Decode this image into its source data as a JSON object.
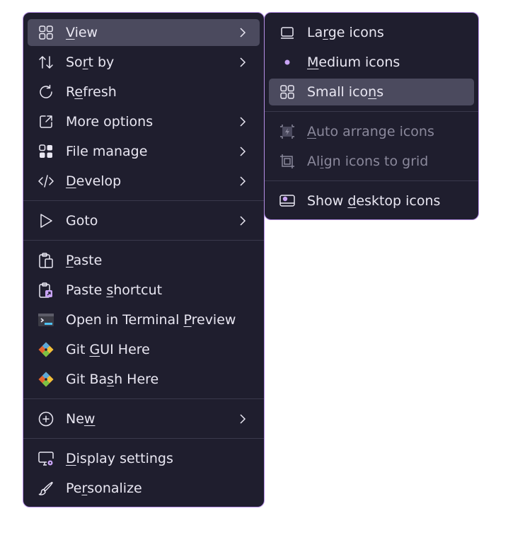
{
  "main_menu": {
    "items": [
      {
        "id": "view",
        "pre": "",
        "ul": "V",
        "post": "iew",
        "icon": "grid-icon",
        "submenu": true,
        "highlighted": true
      },
      {
        "id": "sort-by",
        "pre": "So",
        "ul": "r",
        "post": "t by",
        "icon": "sort-icon",
        "submenu": true
      },
      {
        "id": "refresh",
        "pre": "R",
        "ul": "e",
        "post": "fresh",
        "icon": "refresh-icon",
        "submenu": false
      },
      {
        "id": "more-options",
        "pre": "More options",
        "ul": "",
        "post": "",
        "icon": "external-link-icon",
        "submenu": true
      },
      {
        "id": "file-manage",
        "pre": "File manage",
        "ul": "",
        "post": "",
        "icon": "apps-icon",
        "submenu": true
      },
      {
        "id": "develop",
        "pre": "",
        "ul": "D",
        "post": "evelop",
        "icon": "code-icon",
        "submenu": true
      },
      {
        "id": "goto",
        "pre": "Goto",
        "ul": "",
        "post": "",
        "icon": "cursor-icon",
        "submenu": true
      },
      {
        "id": "paste",
        "pre": "",
        "ul": "P",
        "post": "aste",
        "icon": "paste-icon",
        "submenu": false
      },
      {
        "id": "paste-shortcut",
        "pre": "Paste ",
        "ul": "s",
        "post": "hortcut",
        "icon": "paste-shortcut-icon",
        "submenu": false
      },
      {
        "id": "open-terminal",
        "pre": "Open in Terminal ",
        "ul": "P",
        "post": "review",
        "icon": "terminal-icon",
        "submenu": false
      },
      {
        "id": "git-gui",
        "pre": "Git ",
        "ul": "G",
        "post": "UI Here",
        "icon": "git-icon",
        "submenu": false
      },
      {
        "id": "git-bash",
        "pre": "Git Ba",
        "ul": "s",
        "post": "h Here",
        "icon": "git-icon",
        "submenu": false
      },
      {
        "id": "new",
        "pre": "Ne",
        "ul": "w",
        "post": "",
        "icon": "plus-circle-icon",
        "submenu": true
      },
      {
        "id": "display-settings",
        "pre": "",
        "ul": "D",
        "post": "isplay settings",
        "icon": "display-settings-icon",
        "submenu": false
      },
      {
        "id": "personalize",
        "pre": "Pe",
        "ul": "r",
        "post": "sonalize",
        "icon": "brush-icon",
        "submenu": false
      }
    ]
  },
  "sub_menu": {
    "items": [
      {
        "id": "large-icons",
        "pre": "La",
        "ul": "r",
        "post": "ge icons",
        "icon": "large-icon",
        "state": "normal"
      },
      {
        "id": "medium-icons",
        "pre": "",
        "ul": "M",
        "post": "edium icons",
        "icon": "bullet-icon",
        "state": "selected"
      },
      {
        "id": "small-icons",
        "pre": "Small ico",
        "ul": "n",
        "post": "s",
        "icon": "grid-icon",
        "state": "highlighted"
      },
      {
        "id": "auto-arrange",
        "pre": "",
        "ul": "A",
        "post": "uto arrange icons",
        "icon": "auto-arrange-icon",
        "state": "disabled"
      },
      {
        "id": "align-grid",
        "pre": "Al",
        "ul": "i",
        "post": "gn icons to grid",
        "icon": "align-grid-icon",
        "state": "disabled"
      },
      {
        "id": "show-desktop",
        "pre": "Show ",
        "ul": "d",
        "post": "esktop icons",
        "icon": "show-desktop-icon",
        "state": "normal"
      }
    ]
  },
  "colors": {
    "menu_bg": "#1f1e2e",
    "border": "#b48ee6",
    "highlight": "#4b4a5e",
    "text": "#e9e7f2",
    "disabled_text": "#8a889b",
    "accent": "#c9a4f5"
  }
}
